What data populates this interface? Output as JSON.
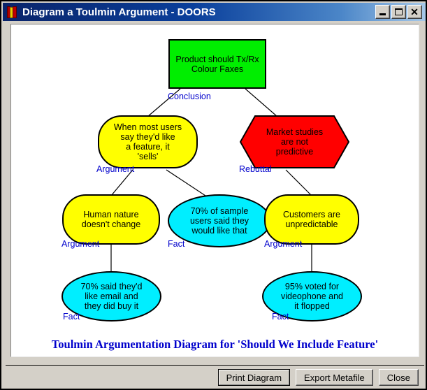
{
  "window": {
    "title": "Diagram a Toulmin Argument - DOORS",
    "icon": "doors-books-icon",
    "controls": {
      "minimize": "minimize-icon",
      "maximize": "maximize-icon",
      "close": "close-icon"
    }
  },
  "diagram": {
    "caption": "Toulmin Argumentation Diagram for 'Should We Include Feature'",
    "colors": {
      "conclusion": "#00ee00",
      "argument": "#ffff00",
      "rebuttal": "#ff0000",
      "fact": "#00eeff",
      "label": "#0000cc",
      "outline": "#000000"
    },
    "nodes": [
      {
        "id": "conclusion",
        "text": "Product should Tx/Rx\nColour Faxes",
        "label": "Conclusion",
        "shape": "rect",
        "color": "#00ee00"
      },
      {
        "id": "argument-sells",
        "text": "When most users\nsay they'd like\na feature, it\n'sells'",
        "label": "Argument",
        "shape": "pill",
        "color": "#ffff00"
      },
      {
        "id": "rebuttal-market-studies",
        "text": "Market studies\nare not\npredictive",
        "label": "Rebuttal",
        "shape": "hexagon",
        "color": "#ff0000"
      },
      {
        "id": "argument-human-nature",
        "text": "Human nature\ndoesn't change",
        "label": "Argument",
        "shape": "pill",
        "color": "#ffff00"
      },
      {
        "id": "fact-70-percent-sample",
        "text": "70% of sample\nusers said they\nwould like that",
        "label": "Fact",
        "shape": "ellipse",
        "color": "#00eeff"
      },
      {
        "id": "argument-customers-unpredictable",
        "text": "Customers are\nunpredictable",
        "label": "Argument",
        "shape": "pill",
        "color": "#ffff00"
      },
      {
        "id": "fact-70-percent-email",
        "text": "70% said they'd\nlike email and\nthey did buy it",
        "label": "Fact",
        "shape": "ellipse",
        "color": "#00eeff"
      },
      {
        "id": "fact-95-percent-videophone",
        "text": "95% voted for\nvideophone and\nit flopped",
        "label": "Fact",
        "shape": "ellipse",
        "color": "#00eeff"
      }
    ]
  },
  "buttons": {
    "print": "Print Diagram",
    "export": "Export Metafile",
    "close": "Close"
  }
}
